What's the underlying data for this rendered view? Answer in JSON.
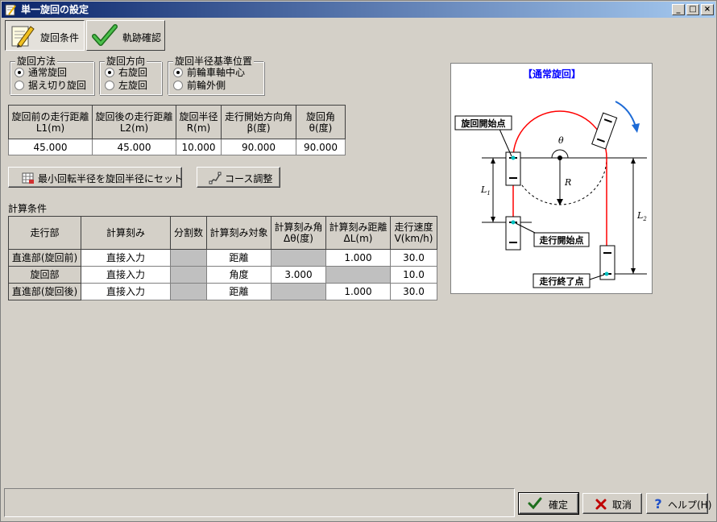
{
  "window": {
    "title": "単一旋回の設定",
    "minimize": "_",
    "maximize": "□",
    "close": "×"
  },
  "tabs": [
    {
      "label": "旋回条件",
      "icon": "pencil-paper-icon",
      "active": true
    },
    {
      "label": "軌跡確認",
      "icon": "checkmark-icon",
      "active": false
    }
  ],
  "turn_method": {
    "title": "旋回方法",
    "options": [
      "通常旋回",
      "据え切り旋回"
    ],
    "selected": 0
  },
  "turn_direction": {
    "title": "旋回方向",
    "options": [
      "右旋回",
      "左旋回"
    ],
    "selected": 0
  },
  "radius_reference": {
    "title": "旋回半径基準位置",
    "options": [
      "前輪車軸中心",
      "前輪外側"
    ],
    "selected": 0
  },
  "params_table": {
    "headers": [
      [
        "旋回前の走行距離",
        "L1(m)"
      ],
      [
        "旋回後の走行距離",
        "L2(m)"
      ],
      [
        "旋回半径",
        "R(m)"
      ],
      [
        "走行開始方向角",
        "β(度)"
      ],
      [
        "旋回角",
        "θ(度)"
      ]
    ],
    "values": [
      "45.000",
      "45.000",
      "10.000",
      "90.000",
      "90.000"
    ]
  },
  "buttons": {
    "set_min_radius": "最小回転半径を旋回半径にセット",
    "course_adjust": "コース調整"
  },
  "calc_conditions": {
    "title": "計算条件",
    "headers": [
      "走行部",
      "計算刻み",
      "分割数",
      "計算刻み対象",
      [
        "計算刻み角",
        "Δθ(度)"
      ],
      [
        "計算刻み距離",
        "ΔL(m)"
      ],
      [
        "走行速度",
        "V(km/h)"
      ]
    ],
    "rows": [
      {
        "part": "直進部(旋回前)",
        "step": "直接入力",
        "divisions": "",
        "target": "距離",
        "angle": "",
        "distance": "1.000",
        "speed": "30.0"
      },
      {
        "part": "旋回部",
        "step": "直接入力",
        "divisions": "",
        "target": "角度",
        "angle": "3.000",
        "distance": "",
        "speed": "10.0"
      },
      {
        "part": "直進部(旋回後)",
        "step": "直接入力",
        "divisions": "",
        "target": "距離",
        "angle": "",
        "distance": "1.000",
        "speed": "30.0"
      }
    ]
  },
  "diagram": {
    "title": "【通常旋回】",
    "labels": {
      "turn_start": "旋回開始点",
      "run_start": "走行開始点",
      "run_end": "走行終了点",
      "theta": "θ",
      "R": "R",
      "L1": "L",
      "L1_sub": "1",
      "L2": "L",
      "L2_sub": "2"
    },
    "colors": {
      "title": "#0000ff",
      "path": "#ff0000",
      "arrow": "#1e6bd6"
    }
  },
  "footer": {
    "ok": "確定",
    "cancel": "取消",
    "help": "ヘルプ(H)"
  }
}
